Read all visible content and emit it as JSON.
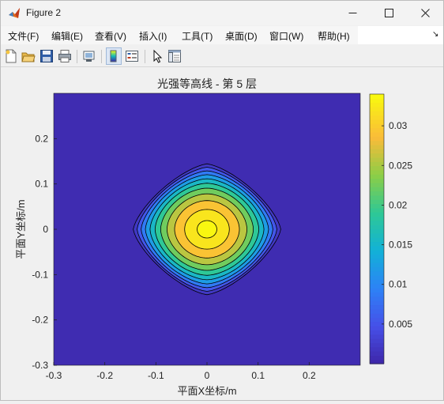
{
  "window": {
    "title": "Figure 2",
    "controls": [
      "minimize",
      "maximize",
      "close"
    ]
  },
  "menubar": {
    "items": [
      "文件(F)",
      "编辑(E)",
      "查看(V)",
      "插入(I)",
      "工具(T)",
      "桌面(D)",
      "窗口(W)",
      "帮助(H)"
    ],
    "overflow_arrow": "↘"
  },
  "toolbar": {
    "buttons": [
      "new-figure-icon",
      "open-file-icon",
      "save-icon",
      "print-icon",
      "link-plot-icon",
      "colorbar-icon",
      "legend-icon",
      "pointer-icon",
      "property-inspector-icon"
    ],
    "pressed": [
      "colorbar-icon"
    ]
  },
  "chart_data": {
    "type": "contour",
    "title": "光强等高线 - 第 5 层",
    "xlabel": "平面X坐标/m",
    "ylabel": "平面Y坐标/m",
    "xlim": [
      -0.3,
      0.3
    ],
    "ylim": [
      -0.3,
      0.3
    ],
    "xticks": [
      -0.3,
      -0.2,
      -0.1,
      0,
      0.1,
      0.2
    ],
    "xtick_labels": [
      "-0.3",
      "-0.2",
      "-0.1",
      "0",
      "0.1",
      "0.2"
    ],
    "yticks": [
      -0.3,
      -0.2,
      -0.1,
      0,
      0.1,
      0.2
    ],
    "ytick_labels": [
      "-0.3",
      "-0.2",
      "-0.1",
      "0",
      "0.1",
      "0.2"
    ],
    "filled": true,
    "contour_lines": true,
    "peak_center": [
      0,
      0
    ],
    "peak_value": 0.034,
    "levels": [
      0.0003,
      0.0037,
      0.0071,
      0.0105,
      0.0139,
      0.0173,
      0.0207,
      0.0241,
      0.0275,
      0.0309,
      0.0334
    ],
    "colormap": "parula",
    "colorbar": {
      "range": [
        0,
        0.034
      ],
      "ticks": [
        0.005,
        0.01,
        0.015,
        0.02,
        0.025,
        0.03
      ],
      "tick_labels": [
        "0.005",
        "0.01",
        "0.015",
        "0.02",
        "0.025",
        "0.03"
      ]
    },
    "grid": false
  }
}
